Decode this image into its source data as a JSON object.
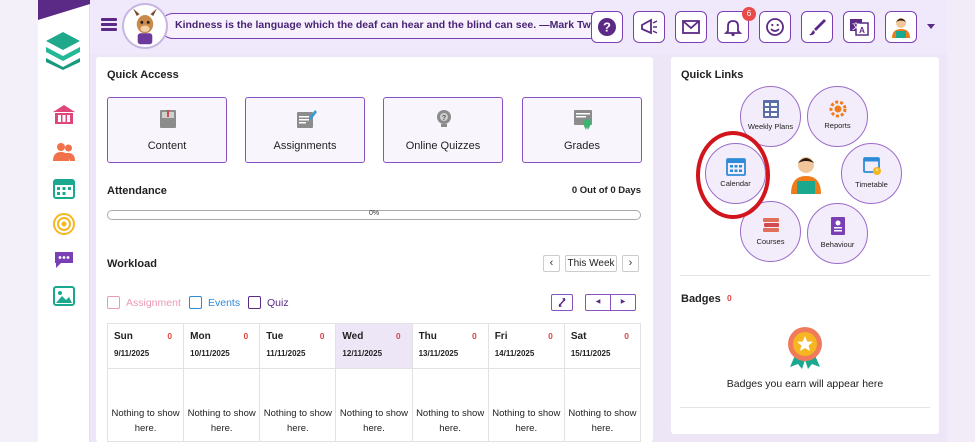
{
  "header": {
    "quote": "Kindness is the language which the deaf can hear and the blind can see. —Mark Twain",
    "notification_count": "6",
    "icons": [
      "help-icon",
      "announcement-icon",
      "mail-icon",
      "bell-icon",
      "smiley-icon",
      "paint-brush-icon",
      "translate-icon",
      "user-avatar-icon"
    ]
  },
  "sidebar": {
    "icons": [
      "home-icon",
      "people-icon",
      "calendar-icon",
      "target-icon",
      "chat-icon",
      "image-icon"
    ]
  },
  "quick_access": {
    "title": "Quick Access",
    "tiles": [
      "Content",
      "Assignments",
      "Online Quizzes",
      "Grades"
    ]
  },
  "attendance": {
    "title": "Attendance",
    "summary": "0 Out of 0 Days",
    "progress_text": "0%",
    "progress_value": 0
  },
  "workload": {
    "title": "Workload",
    "week_label": "This Week",
    "prev_symbol": "‹",
    "next_symbol": "›",
    "legend": [
      {
        "label": "Assignment",
        "color": "#e99ab5"
      },
      {
        "label": "Events",
        "color": "#2e8bd8"
      },
      {
        "label": "Quiz",
        "color": "#5b2a86"
      }
    ],
    "days": [
      {
        "name": "Sun",
        "date": "9/11/2025",
        "count": "0",
        "empty": "Nothing to show here."
      },
      {
        "name": "Mon",
        "date": "10/11/2025",
        "count": "0",
        "empty": "Nothing to show here."
      },
      {
        "name": "Tue",
        "date": "11/11/2025",
        "count": "0",
        "empty": "Nothing to show here."
      },
      {
        "name": "Wed",
        "date": "12/11/2025",
        "count": "0",
        "empty": "Nothing to show here."
      },
      {
        "name": "Thu",
        "date": "13/11/2025",
        "count": "0",
        "empty": "Nothing to show here."
      },
      {
        "name": "Fri",
        "date": "14/11/2025",
        "count": "0",
        "empty": "Nothing to show here."
      },
      {
        "name": "Sat",
        "date": "15/11/2025",
        "count": "0",
        "empty": "Nothing to show here."
      }
    ]
  },
  "quick_links": {
    "title": "Quick Links",
    "items": [
      "Weekly Plans",
      "Reports",
      "Calendar",
      "Timetable",
      "Courses",
      "Behaviour"
    ]
  },
  "badges": {
    "title": "Badges",
    "count": "0",
    "empty": "Badges you earn will appear here"
  },
  "colors": {
    "accent": "#7b3fb5",
    "highlight": "#d2141c",
    "count_red": "#e04545"
  }
}
